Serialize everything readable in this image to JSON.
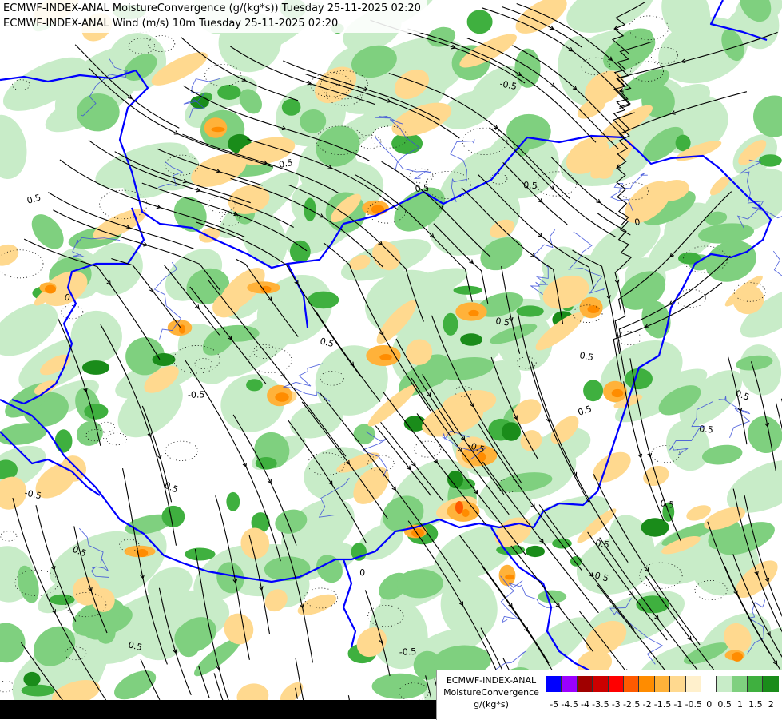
{
  "header": {
    "line1": "ECMWF-INDEX-ANAL MoistureConvergence (g/(kg*s)) Tuesday 25-11-2025 02:20",
    "line2": "ECMWF-INDEX-ANAL Wind (m/s) 10m Tuesday 25-11-2025 02:20"
  },
  "legend": {
    "title_line1": "ECMWF-INDEX-ANAL",
    "title_line2": "MoistureConvergence",
    "title_line3": "g/(kg*s)",
    "labels": [
      "-5",
      "-4.5",
      "-4",
      "-3.5",
      "-3",
      "-2.5",
      "-2",
      "-1.5",
      "-1",
      "-0.5",
      "0",
      "0.5",
      "1",
      "1.5",
      "2"
    ],
    "colors": [
      "#0000ff",
      "#9a00ff",
      "#a00000",
      "#cc0000",
      "#ff0000",
      "#ff5a00",
      "#ff8c00",
      "#ffb23a",
      "#ffd98f",
      "#fff0cc",
      "#ffffff",
      "#c8ecc8",
      "#7fd07f",
      "#3fb03f",
      "#1a8c1a"
    ]
  },
  "map": {
    "contour_labels": [
      "0.5",
      "-0.5",
      "0.5",
      "0",
      "0.5",
      "-0.5",
      "0.5",
      "0.5",
      "-0.5",
      "0.5",
      "0",
      "0.5",
      "0.5",
      "-0.5",
      "0.5",
      "0.5",
      "0.5",
      "-0.5",
      "0.5",
      "0",
      "0.5",
      "0.5",
      "-0.5",
      "0.5"
    ],
    "colors": {
      "background": "#ffffff",
      "pos_light": "#c8ecc8",
      "pos_mid": "#7fd07f",
      "pos_strong": "#3fb03f",
      "pos_max": "#1a8c1a",
      "neg_light": "#ffd98f",
      "neg_mid": "#ffb23a",
      "neg_strong": "#ff8c00",
      "neg_max": "#ff5a00",
      "border": "#0000ff",
      "river": "#3c50d8",
      "streamline": "#000000"
    }
  }
}
